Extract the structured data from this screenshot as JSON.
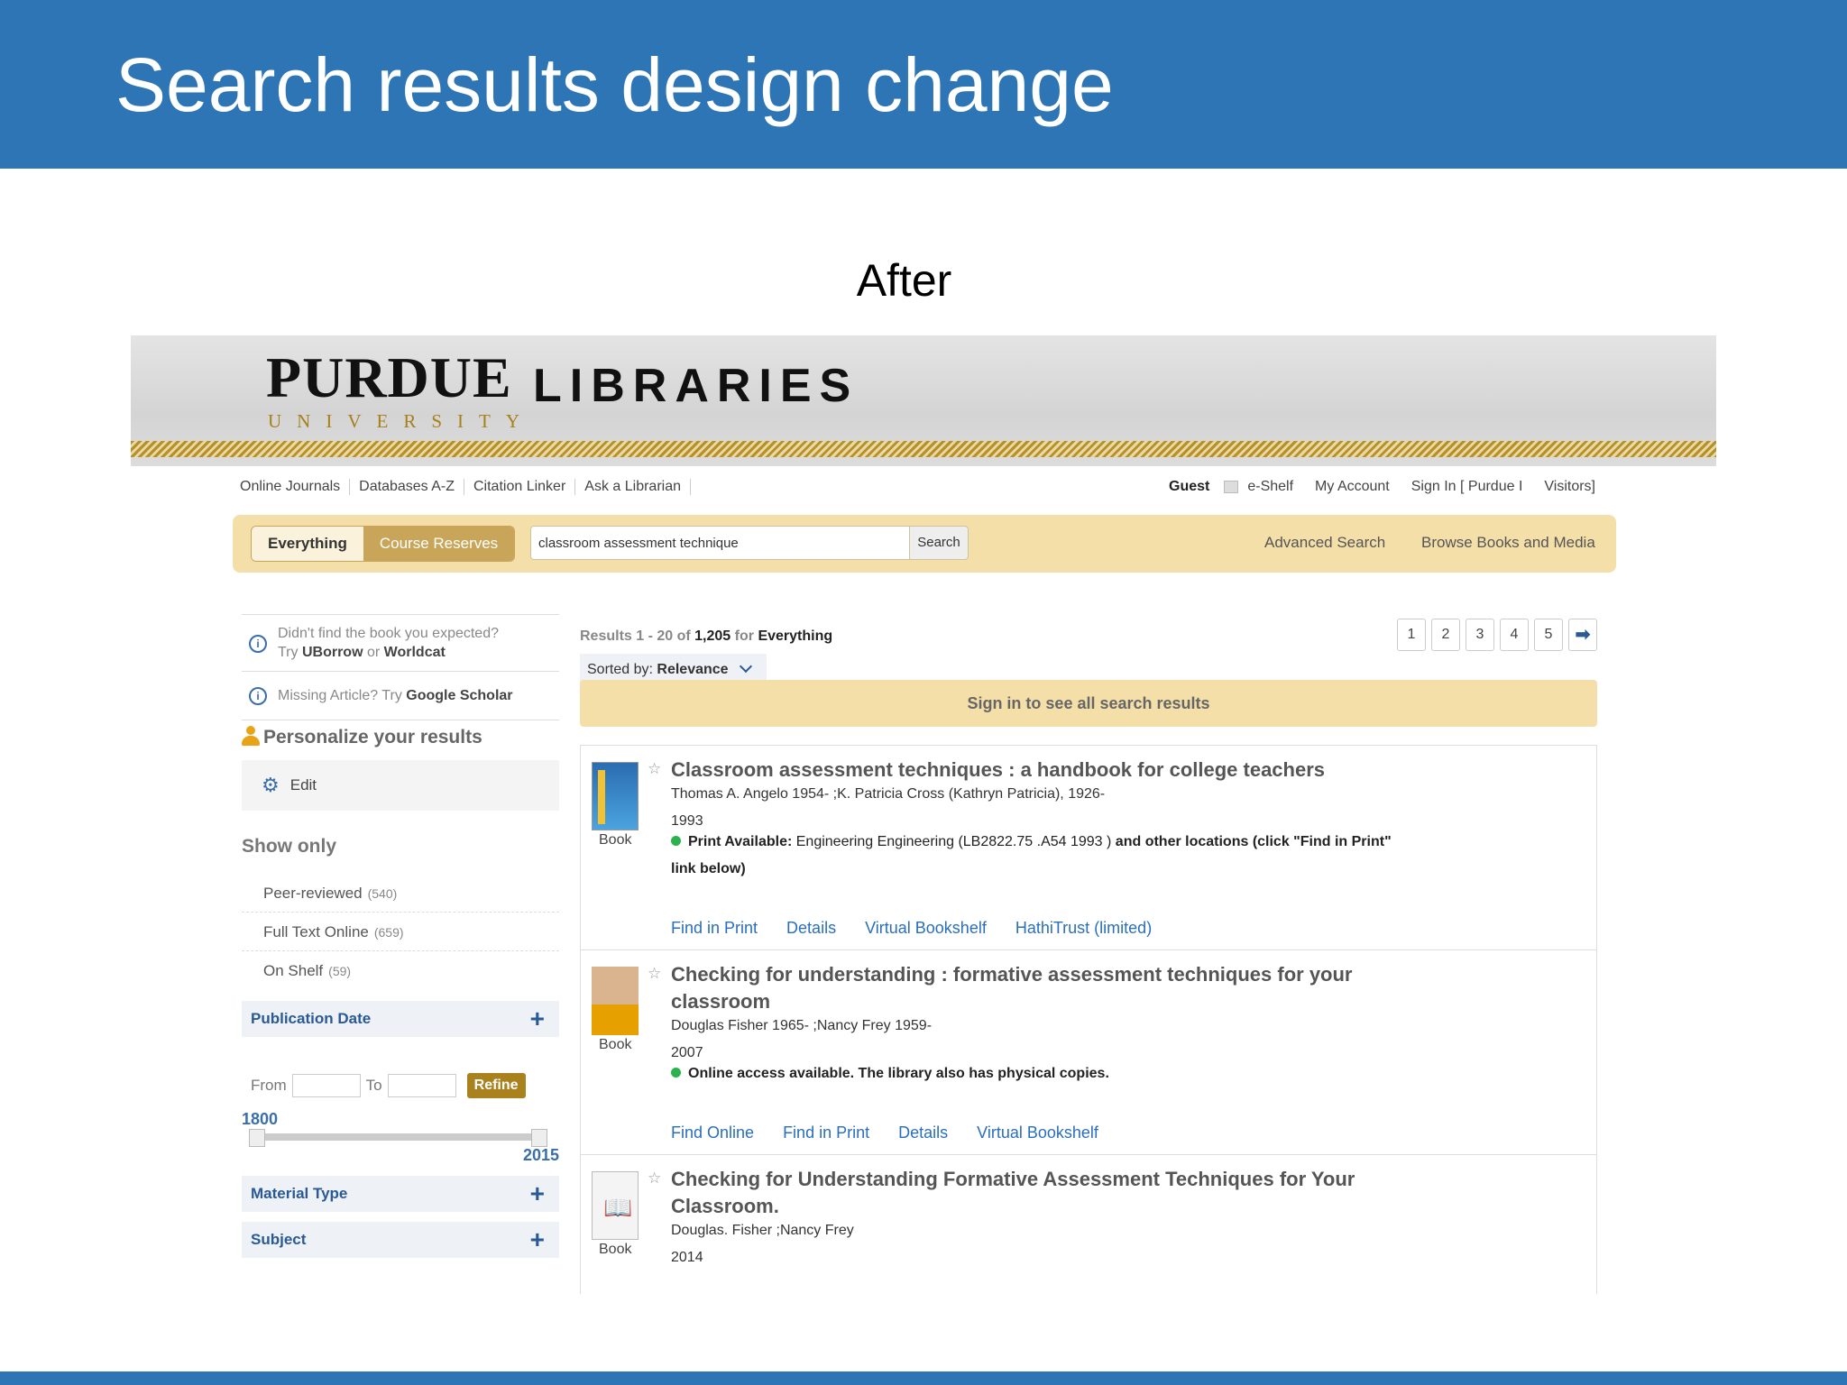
{
  "slide": {
    "title": "Search results design change",
    "subtitle": "After"
  },
  "banner": {
    "logo_main": "PURDUE",
    "logo_sub": "UNIVERSITY",
    "logo_libraries": "LIBRARIES"
  },
  "utility_nav": {
    "left": [
      "Online Journals",
      "Databases A-Z",
      "Citation Linker",
      "Ask a Librarian"
    ],
    "guest": "Guest",
    "eshelf": "e-Shelf",
    "my_account": "My Account",
    "sign_in": "Sign In [ Purdue I",
    "visitors": "Visitors]"
  },
  "search": {
    "tabs": [
      "Everything",
      "Course Reserves"
    ],
    "query": "classroom assessment technique",
    "button": "Search",
    "advanced": "Advanced Search",
    "browse": "Browse Books and Media"
  },
  "sidebar": {
    "tip1_line1": "Didn't find the book you expected?",
    "tip1_try": "Try",
    "tip1_link1": "UBorrow",
    "tip1_or": "or",
    "tip1_link2": "Worldcat",
    "tip2_text": "Missing Article? Try",
    "tip2_link": "Google Scholar",
    "personalize": "Personalize your results",
    "edit": "Edit",
    "show_only": "Show only",
    "facets": [
      {
        "label": "Peer-reviewed",
        "count": "(540)"
      },
      {
        "label": "Full Text Online",
        "count": "(659)"
      },
      {
        "label": "On Shelf",
        "count": "(59)"
      }
    ],
    "publication_date": "Publication Date",
    "from": "From",
    "to": "To",
    "refine": "Refine",
    "year_min": "1800",
    "year_max": "2015",
    "material_type": "Material Type",
    "subject": "Subject"
  },
  "results": {
    "range": "Results 1 - 20 of",
    "total": "1,205",
    "for": "for",
    "scope": "Everything",
    "sorted_by": "Sorted by:",
    "sort_value": "Relevance",
    "pages": [
      "1",
      "2",
      "3",
      "4",
      "5"
    ],
    "next": "➡",
    "sign_in_banner": "Sign in to see all search results",
    "records": [
      {
        "title": "Classroom assessment techniques : a handbook for college teachers",
        "authors": "Thomas A. Angelo 1954- ;K. Patricia Cross (Kathryn Patricia), 1926-",
        "year": "1993",
        "type": "Book",
        "avail_label": "Print Available:",
        "avail_text": "Engineering Engineering (LB2822.75 .A54 1993 )",
        "avail_extra": "and other locations (click \"Find in Print\" link below)",
        "links": [
          "Find in Print",
          "Details",
          "Virtual Bookshelf",
          "HathiTrust (limited)"
        ]
      },
      {
        "title": "Checking for understanding : formative assessment techniques for your classroom",
        "authors": "Douglas Fisher 1965- ;Nancy Frey 1959-",
        "year": "2007",
        "type": "Book",
        "avail_label": "Online access available. The library also has physical copies.",
        "links": [
          "Find Online",
          "Find in Print",
          "Details",
          "Virtual Bookshelf"
        ]
      },
      {
        "title": "Checking for Understanding Formative Assessment Techniques for Your Classroom.",
        "authors": "Douglas. Fisher ;Nancy Frey",
        "year": "2014",
        "type": "Book"
      }
    ]
  }
}
